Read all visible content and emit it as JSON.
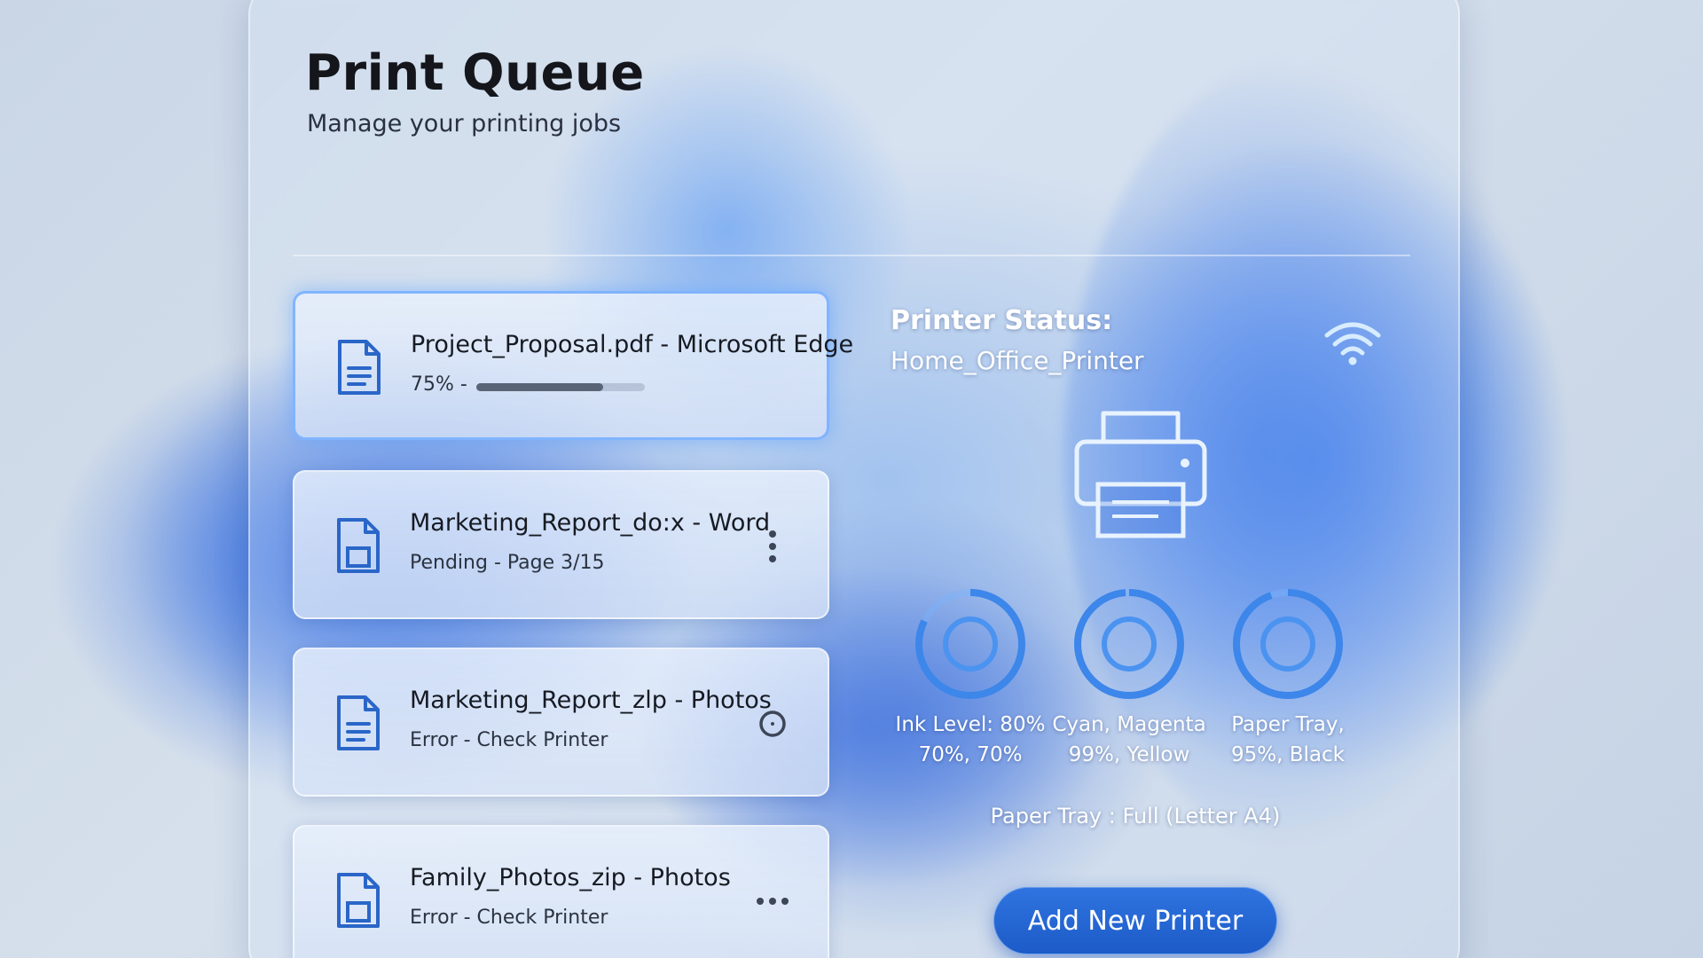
{
  "header": {
    "title": "Print Queue",
    "subtitle": "Manage your printing jobs"
  },
  "jobs": [
    {
      "name": "Project_Proposal.pdf - Microsoft Edge",
      "status": "75% -",
      "progress": 0.75,
      "icon": "document-icon"
    },
    {
      "name": "Marketing_Report_do:x - Word",
      "status": "Pending - Page 3/15",
      "icon": "document-icon",
      "action_icon": "more-vertical-icon"
    },
    {
      "name": "Marketing_Report_zlp - Photos",
      "status": "Error - Check Printer",
      "icon": "document-icon",
      "action_icon": "circle-icon"
    },
    {
      "name": "Family_Photos_zip - Photos",
      "status": "Error - Check Printer",
      "icon": "document-icon",
      "action_icon": "more-horizontal-icon"
    }
  ],
  "printer_status": {
    "title": "Printer Status:",
    "printer_name": "Home_Office_Printer",
    "connection_icon": "wifi-icon",
    "gauges": [
      {
        "line1": "Ink Level: 80%",
        "line2": "70%, 70%"
      },
      {
        "line1": "Cyan, Magenta",
        "line2": "99%, Yellow"
      },
      {
        "line1": "Paper Tray,",
        "line2": "95%, Black"
      }
    ],
    "tray_info": "Paper Tray : Full (Letter A4)"
  },
  "actions": {
    "add_printer_label": "Add New Printer"
  },
  "colors": {
    "accent": "#2f74e0",
    "gauge_ring": "#3d86ea"
  }
}
